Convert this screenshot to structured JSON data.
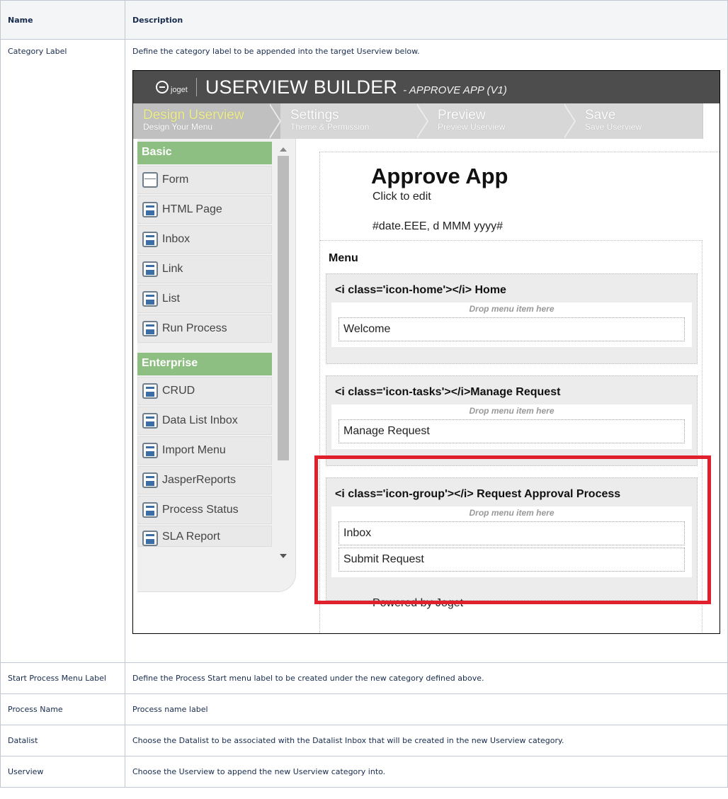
{
  "table": {
    "headers": {
      "name": "Name",
      "description": "Description"
    },
    "rows": [
      {
        "name": "Category Label",
        "description": "Define the category label to be appended into the target Userview below."
      },
      {
        "name": "Start Process Menu Label",
        "description": "Define the Process Start menu label to be created under the new category defined above."
      },
      {
        "name": "Process Name",
        "description": "Process name label"
      },
      {
        "name": "Datalist",
        "description": "Choose the Datalist to be associated with the Datalist Inbox that will be created in the new Userview category."
      },
      {
        "name": "Userview",
        "description": "Choose the Userview to append the new Userview category into."
      }
    ]
  },
  "screenshot": {
    "logo_text": "joget",
    "title": "USERVIEW BUILDER",
    "subtitle": "- APPROVE APP (V1)",
    "steps": [
      {
        "title": "Design Userview",
        "sub": "Design Your Menu"
      },
      {
        "title": "Settings",
        "sub": "Theme & Permission"
      },
      {
        "title": "Preview",
        "sub": "Preview Userview"
      },
      {
        "title": "Save",
        "sub": "Save Userview"
      }
    ],
    "palette": {
      "basic_label": "Basic",
      "basic_items": [
        "Form",
        "HTML Page",
        "Inbox",
        "Link",
        "List",
        "Run Process"
      ],
      "enterprise_label": "Enterprise",
      "enterprise_items": [
        "CRUD",
        "Data List Inbox",
        "Import Menu",
        "JasperReports",
        "Process Status",
        "SLA Report"
      ]
    },
    "canvas": {
      "app_name": "Approve App",
      "click_to_edit": "Click to edit",
      "date": "#date.EEE, d MMM yyyy#",
      "menu_label": "Menu",
      "drop_hint": "Drop menu item here",
      "categories": [
        {
          "title": "<i class='icon-home'></i> Home",
          "items": [
            "Welcome"
          ]
        },
        {
          "title": "<i class='icon-tasks'></i>Manage Request",
          "items": [
            "Manage Request"
          ]
        },
        {
          "title": "<i class='icon-group'></i> Request Approval Process",
          "items": [
            "Inbox",
            "Submit Request"
          ]
        }
      ],
      "footer": "Powered by Joget"
    },
    "highlight_color": "#e0202a"
  }
}
